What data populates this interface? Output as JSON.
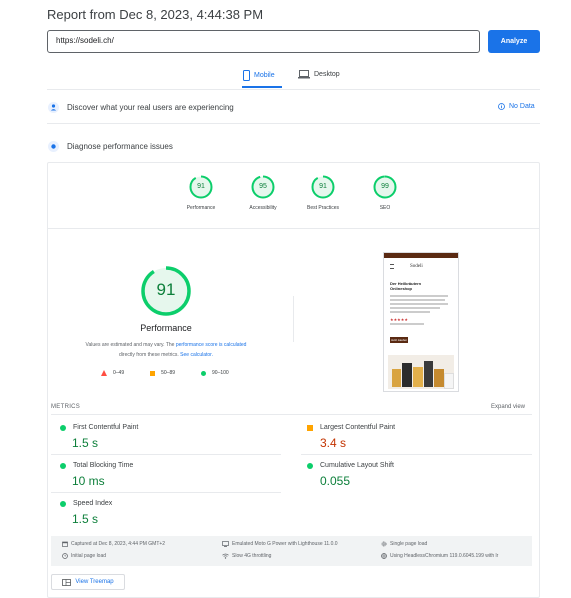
{
  "header": {
    "title": "Report from Dec 8, 2023, 4:44:38 PM"
  },
  "search": {
    "url": "https://sodeli.ch/",
    "analyze_label": "Analyze"
  },
  "tabs": {
    "mobile": "Mobile",
    "desktop": "Desktop"
  },
  "sections": {
    "real_users": "Discover what your real users are experiencing",
    "no_data": "No Data",
    "diagnose": "Diagnose performance issues"
  },
  "scores": [
    {
      "label": "Performance",
      "value": "91"
    },
    {
      "label": "Accessibility",
      "value": "95"
    },
    {
      "label": "Best Practices",
      "value": "91"
    },
    {
      "label": "SEO",
      "value": "99"
    }
  ],
  "main_gauge": {
    "value": "91",
    "label": "Performance",
    "fraction": 0.91
  },
  "note": {
    "part1": "Values are estimated and may vary. The ",
    "link1": "performance score is calculated",
    "part2": "directly from these metrics. ",
    "link2": "See calculator."
  },
  "legend": {
    "red": "0–49",
    "orange": "50–89",
    "green": "90–100"
  },
  "screenshot": {
    "brand": "Sodeli",
    "heading": "Der Heilkräutern Onlineshop",
    "button": "Jetzt kaufen"
  },
  "metrics": {
    "title": "METRICS",
    "expand": "Expand view",
    "fcp_name": "First Contentful Paint",
    "fcp_val": "1.5 s",
    "lcp_name": "Largest Contentful Paint",
    "lcp_val": "3.4 s",
    "tbt_name": "Total Blocking Time",
    "tbt_val": "10 ms",
    "cls_name": "Cumulative Layout Shift",
    "cls_val": "0.055",
    "si_name": "Speed Index",
    "si_val": "1.5 s"
  },
  "footer": {
    "captured": "Captured at Dec 8, 2023, 4:44 PM GMT+2",
    "initial": "Initial page load",
    "device": "Emulated Moto G Power with Lighthouse 11.0.0",
    "throttle": "Slow 4G throttling",
    "single": "Single page load",
    "browser": "Using HeadlessChromium 119.0.6045.199 with lr",
    "treemap": "View Treemap"
  },
  "colors": {
    "pass": "#0cce6b",
    "pass_text": "#0c7f3a",
    "average": "#ffa400",
    "fail": "#ff4e42",
    "accent": "#1a73e8"
  },
  "icons": [
    "mobile-icon",
    "desktop-icon",
    "people-icon",
    "gauge-icon",
    "info-icon",
    "calendar-icon",
    "monitor-icon",
    "wifi-icon",
    "globe-icon",
    "clock-icon",
    "treemap-icon"
  ]
}
